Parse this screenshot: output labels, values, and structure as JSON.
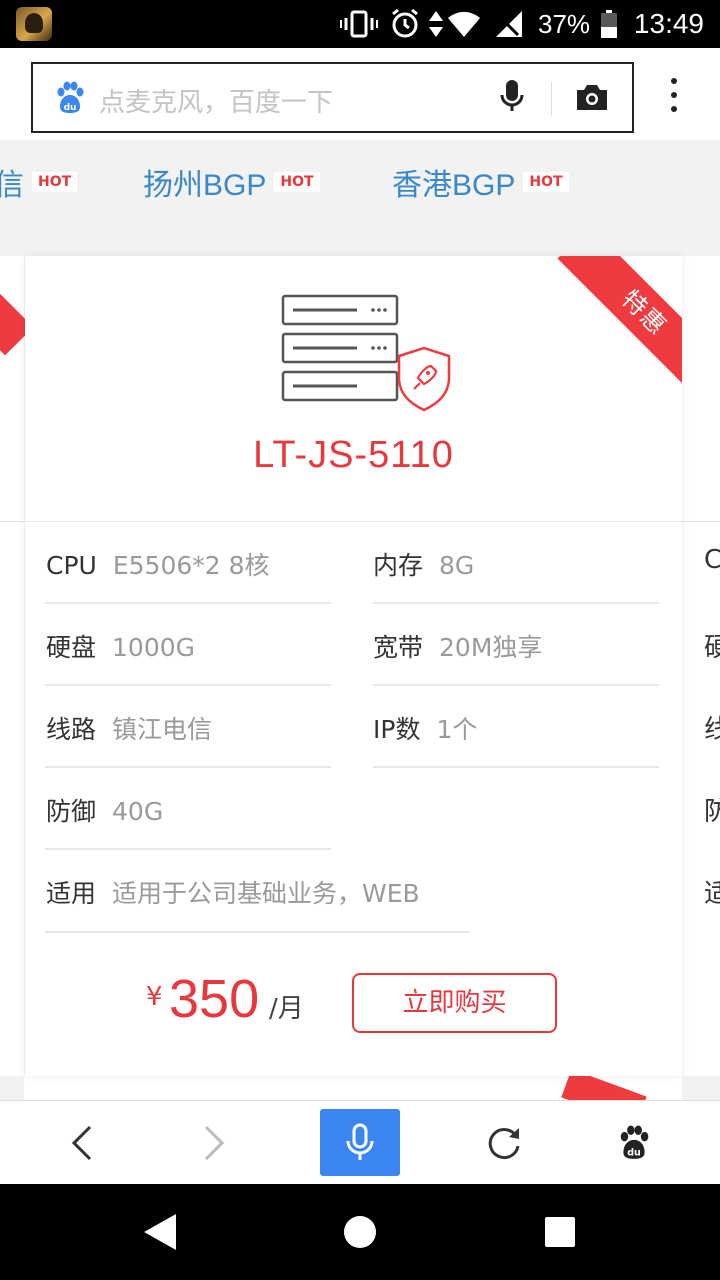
{
  "status_bar": {
    "battery_percent": "37%",
    "time": "13:49"
  },
  "search": {
    "placeholder": "点麦克风，百度一下"
  },
  "tabs": [
    {
      "label": "信",
      "badge": "HOT"
    },
    {
      "label": "扬州BGP",
      "badge": "HOT"
    },
    {
      "label": "香港BGP",
      "badge": "HOT"
    }
  ],
  "card": {
    "ribbon": "特惠",
    "model": "LT-JS-5110",
    "specs": {
      "cpu": {
        "key": "CPU",
        "value": "E5506*2 8核"
      },
      "memory": {
        "key": "内存",
        "value": "8G"
      },
      "disk": {
        "key": "硬盘",
        "value": "1000G"
      },
      "bandwidth": {
        "key": "宽带",
        "value": "20M独享"
      },
      "line": {
        "key": "线路",
        "value": "镇江电信"
      },
      "ip": {
        "key": "IP数",
        "value": "1个"
      },
      "defense": {
        "key": "防御",
        "value": "40G"
      },
      "usage": {
        "key": "适用",
        "value": "适用于公司基础业务，WEB"
      }
    },
    "price": {
      "currency": "¥",
      "amount": "350",
      "unit": "/月"
    },
    "buy_label": "立即购买"
  },
  "peek_right_chars": [
    "C",
    "硬",
    "线",
    "防",
    "适"
  ],
  "colors": {
    "accent_red": "#e8383d",
    "tab_blue": "#3b88c9",
    "voice_blue": "#3b86f0"
  }
}
